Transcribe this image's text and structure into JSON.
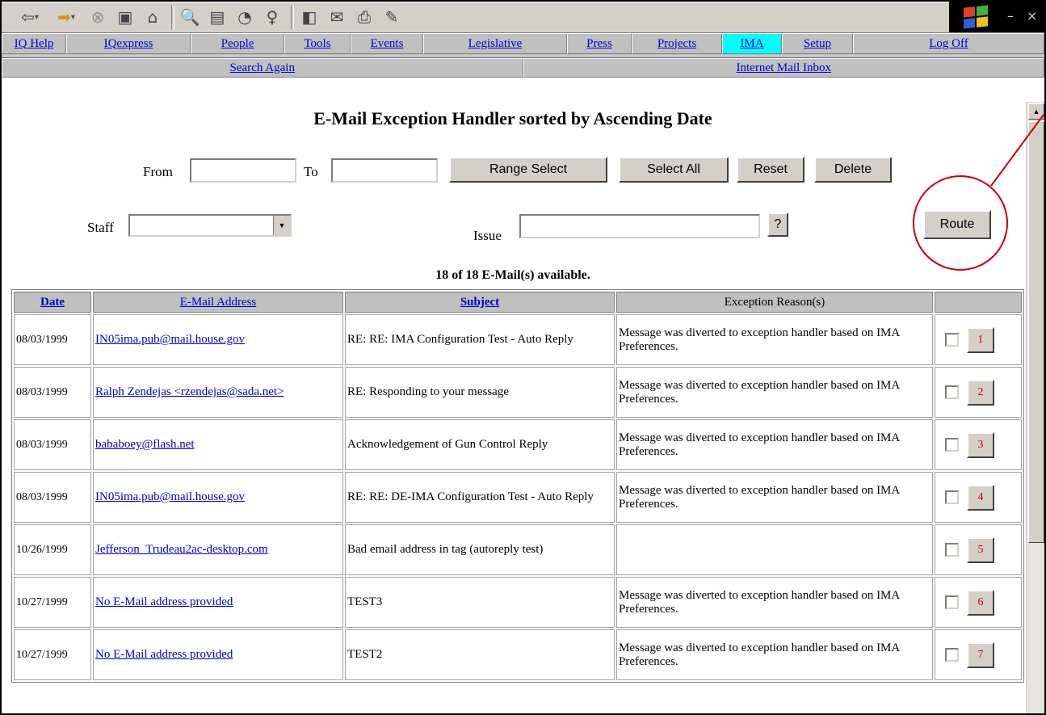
{
  "nav": [
    "IQ Help",
    "IQexpress",
    "People",
    "Tools",
    "Events",
    "Legislative",
    "Press",
    "Projects",
    "IMA",
    "Setup",
    "Log Off"
  ],
  "subnav": {
    "search_again": "Search Again",
    "inbox": "Internet Mail Inbox"
  },
  "title": "E-Mail Exception Handler sorted by Ascending Date",
  "filters": {
    "from_label": "From",
    "to_label": "To",
    "range_select": "Range Select",
    "select_all": "Select All",
    "reset": "Reset",
    "delete": "Delete",
    "staff_label": "Staff",
    "issue_label": "Issue",
    "help": "?",
    "route": "Route"
  },
  "count_text": "18 of 18 E-Mail(s) available.",
  "table": {
    "headers": [
      "Date",
      "E-Mail Address",
      "Subject",
      "Exception Reason(s)"
    ],
    "rows": [
      {
        "date": "08/03/1999",
        "email": "IN05ima.pub@mail.house.gov",
        "subject": "RE: RE: IMA Configuration Test - Auto Reply",
        "reason": "Message was diverted to exception handler based on IMA Preferences.",
        "num": "1"
      },
      {
        "date": "08/03/1999",
        "email": "Ralph Zendejas <rzendejas@sada.net>",
        "subject": "RE: Responding to your message",
        "reason": "Message was diverted to exception handler based on IMA Preferences.",
        "num": "2"
      },
      {
        "date": "08/03/1999",
        "email": "bababoey@flash.net",
        "subject": "Acknowledgement of Gun Control Reply",
        "reason": "Message was diverted to exception handler based on IMA Preferences.",
        "num": "3"
      },
      {
        "date": "08/03/1999",
        "email": "IN05ima.pub@mail.house.gov",
        "subject": "RE: RE: DE-IMA Configuration Test - Auto Reply",
        "reason": "Message was diverted to exception handler based on IMA Preferences.",
        "num": "4"
      },
      {
        "date": "10/26/1999",
        "email": "Jefferson_Trudeau2ac-desktop.com",
        "subject": "Bad email address in tag (autoreply test)",
        "reason": "",
        "num": "5"
      },
      {
        "date": "10/27/1999",
        "email": "No E-Mail address provided",
        "subject": "TEST3",
        "reason": "Message was diverted to exception handler based on IMA Preferences.",
        "num": "6"
      },
      {
        "date": "10/27/1999",
        "email": "No E-Mail address provided",
        "subject": "TEST2",
        "reason": "Message was diverted to exception handler based on IMA Preferences.",
        "num": "7"
      }
    ]
  },
  "toolbar_icons": [
    "back-icon",
    "forward-icon",
    "stop-icon",
    "refresh-icon",
    "home-icon",
    "search-icon",
    "favorites-icon",
    "history-icon",
    "channels-icon",
    "fullscreen-icon",
    "mail-icon",
    "print-icon",
    "edit-icon"
  ],
  "colors": {
    "link": "#0000cc",
    "active_tab": "#00ffff",
    "annotation": "#cc0000",
    "chrome": "#c0c0c0"
  }
}
